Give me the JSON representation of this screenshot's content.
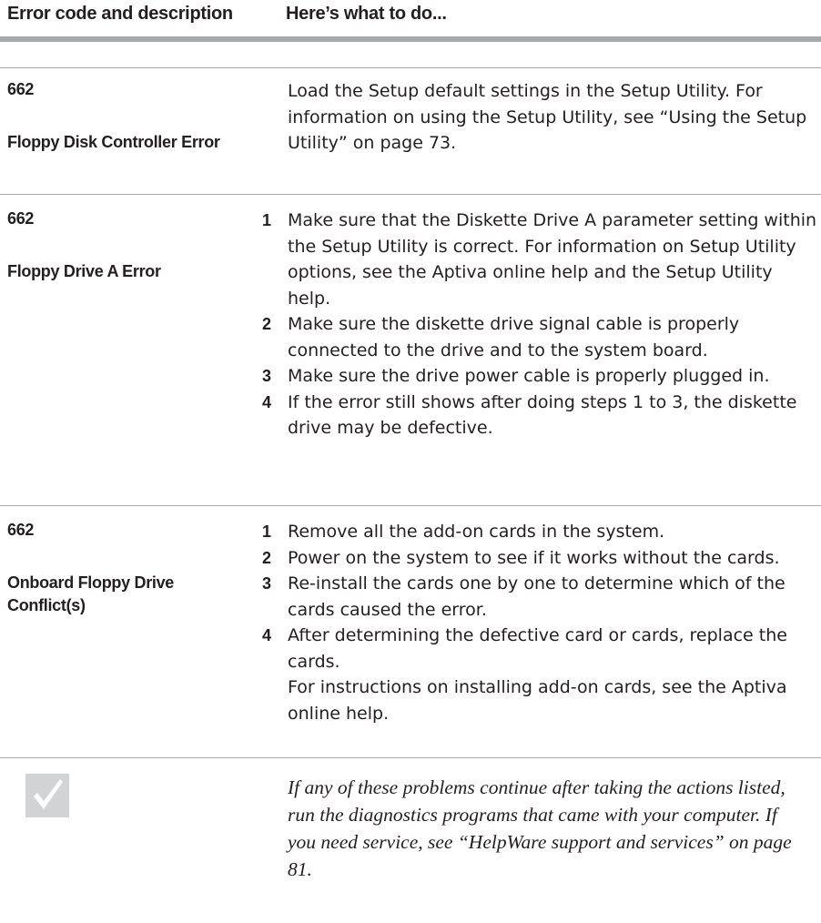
{
  "header": {
    "col1": "Error code and description",
    "col2": "Here’s what to do..."
  },
  "entries": [
    {
      "code": "662",
      "description": "Floppy Disk Controller Error",
      "text": "Load the Setup default settings in the Setup Utility. For information on using the Setup Utility, see “Using the Setup Utility” on page 73."
    },
    {
      "code": "662",
      "description": "Floppy Drive A Error",
      "steps": [
        {
          "num": "1",
          "text": "Make sure that the Diskette Drive A parameter setting within the Setup Utility is correct. For information on Setup Utility options, see the Aptiva online help and the Setup Utility help."
        },
        {
          "num": "2",
          "text": "Make sure the diskette drive signal cable is properly connected to the drive and to the system board."
        },
        {
          "num": "3",
          "text": "Make sure the drive power cable is properly plugged in."
        },
        {
          "num": "4",
          "text": "If the error still shows after doing steps 1 to 3, the diskette drive may be defective."
        }
      ]
    },
    {
      "code": "662",
      "description": "Onboard Floppy Drive Conflict(s)",
      "steps": [
        {
          "num": "1",
          "text": "Remove all the add-on cards in the system."
        },
        {
          "num": "2",
          "text": "Power on the system to see if it works without the cards."
        },
        {
          "num": "3",
          "text": "Re-install the cards one by one to determine which of the cards caused the error."
        },
        {
          "num": "4",
          "text": "After determining the defective card or cards, replace the cards."
        }
      ],
      "after_steps": "For instructions on installing add-on cards, see the Aptiva online help."
    }
  ],
  "note": {
    "icon": "checkmark-icon",
    "text": "If any of these problems continue after taking the actions listed, run the diagnostics programs that came with your computer. If you need service, see “HelpWare support and services” on page 81."
  }
}
